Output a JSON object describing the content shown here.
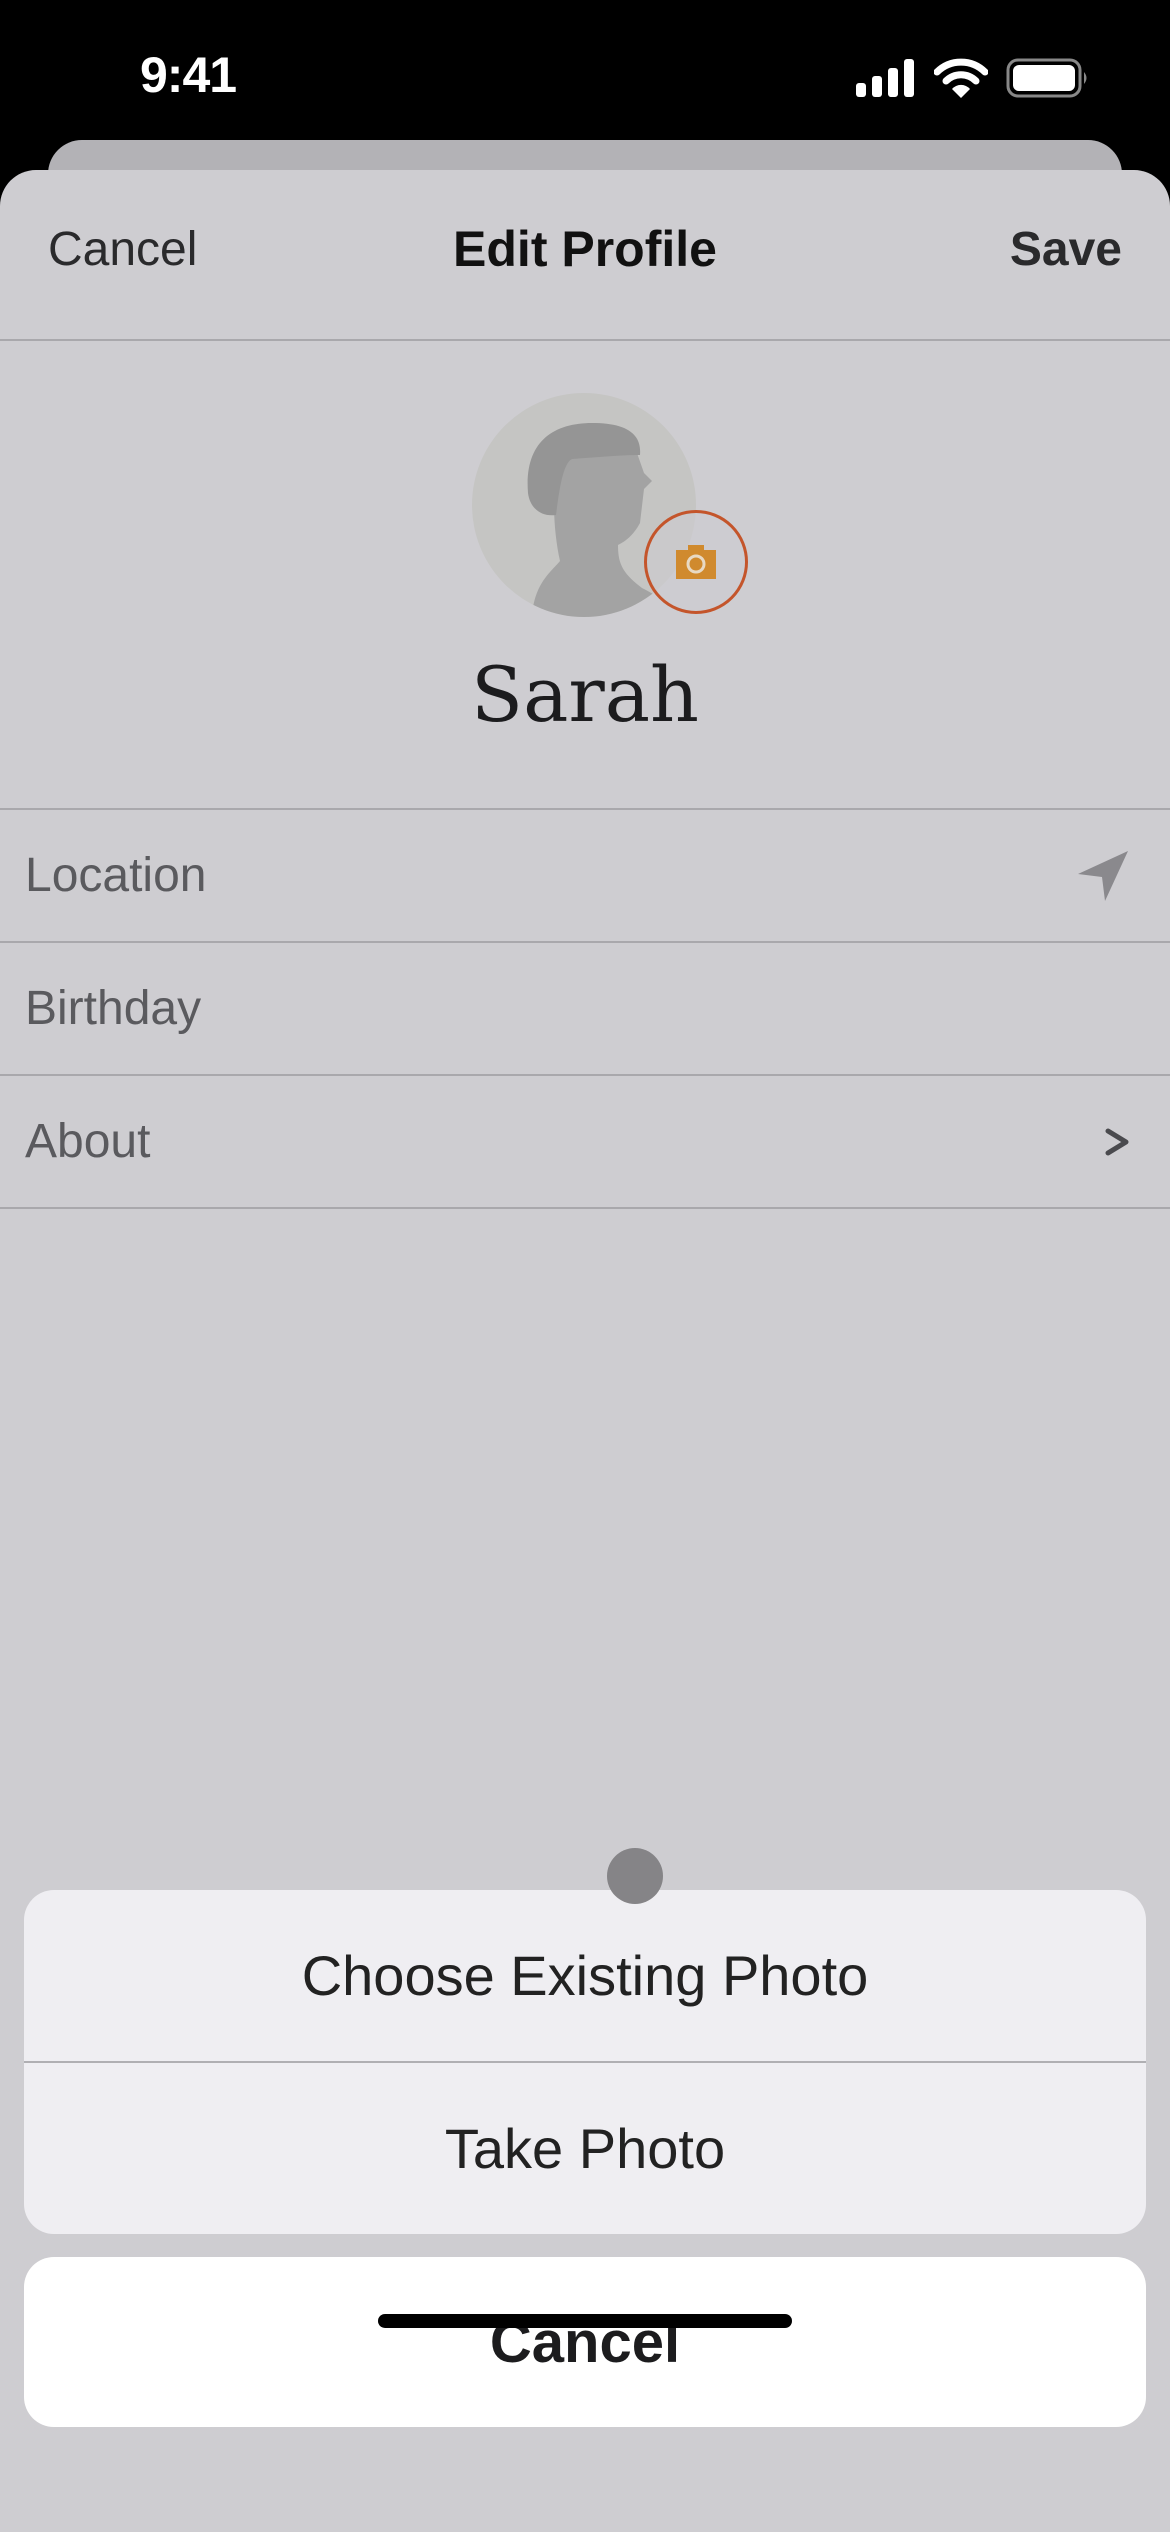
{
  "status_bar": {
    "time": "9:41",
    "icons": [
      "cellular-signal-icon",
      "wifi-icon",
      "battery-icon"
    ]
  },
  "nav": {
    "cancel_label": "Cancel",
    "title": "Edit Profile",
    "save_label": "Save"
  },
  "profile": {
    "name": "Sarah",
    "avatar_icon": "person-silhouette-icon",
    "camera_icon": "camera-icon"
  },
  "fields": [
    {
      "label": "Location",
      "icon": "location-arrow-icon"
    },
    {
      "label": "Birthday",
      "icon": ""
    },
    {
      "label": "About",
      "icon": "chevron-right-icon",
      "icon_glyph": ">"
    }
  ],
  "action_sheet": {
    "options": [
      "Choose Existing Photo",
      "Take Photo"
    ],
    "cancel_label": "Cancel"
  },
  "colors": {
    "accent": "#c4552b",
    "camera_fill": "#d08a2e",
    "sheet_bg": "#cecdd1",
    "action_bg": "#efeef2"
  }
}
